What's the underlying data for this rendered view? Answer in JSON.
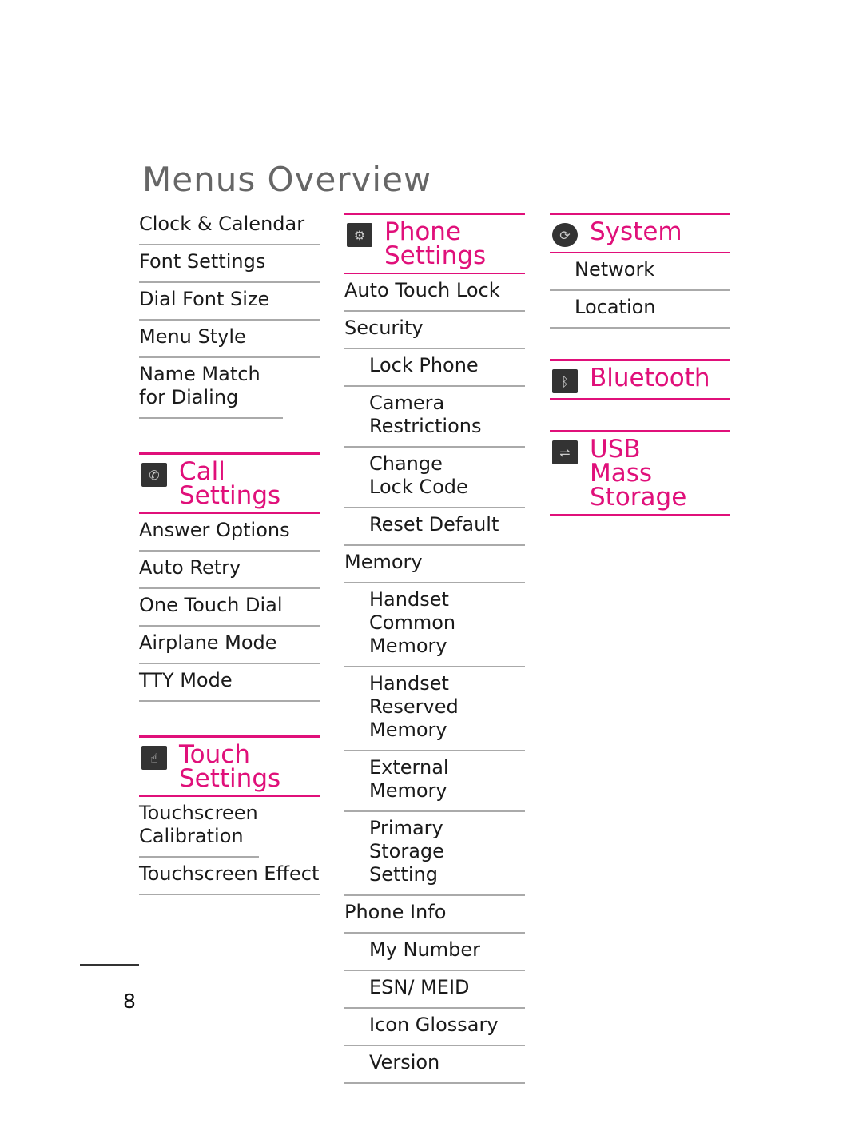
{
  "title": "Menus Overview",
  "page_number": "8",
  "accent_color": "#e0107a",
  "column1": {
    "top_items": [
      "Clock & Calendar",
      "Font Settings",
      "Dial Font Size",
      "Menu Style",
      "Name Match for Dialing"
    ],
    "call_settings": {
      "label": "Call Settings",
      "icon": "phone-gear-icon",
      "items": [
        "Answer Options",
        "Auto Retry",
        "One Touch Dial",
        "Airplane Mode",
        "TTY Mode"
      ]
    },
    "touch_settings": {
      "label": "Touch Settings",
      "icon": "touch-icon",
      "items": [
        "Touchscreen Calibration",
        "Touchscreen Effect"
      ]
    }
  },
  "column2": {
    "phone_settings": {
      "label": "Phone Settings",
      "icon": "phone-settings-icon",
      "items": [
        {
          "label": "Auto Touch Lock",
          "sub": false
        },
        {
          "label": "Security",
          "sub": false
        },
        {
          "label": "Lock Phone",
          "sub": true
        },
        {
          "label": "Camera Restrictions",
          "sub": true
        },
        {
          "label": "Change Lock Code",
          "sub": true
        },
        {
          "label": "Reset Default",
          "sub": true
        },
        {
          "label": "Memory",
          "sub": false
        },
        {
          "label": "Handset Common Memory",
          "sub": true
        },
        {
          "label": "Handset Reserved Memory",
          "sub": true
        },
        {
          "label": "External Memory",
          "sub": true
        },
        {
          "label": "Primary Storage Setting",
          "sub": true
        },
        {
          "label": "Phone Info",
          "sub": false
        },
        {
          "label": "My Number",
          "sub": true
        },
        {
          "label": "ESN/ MEID",
          "sub": true
        },
        {
          "label": "Icon Glossary",
          "sub": true
        },
        {
          "label": "Version",
          "sub": true
        }
      ]
    }
  },
  "column3": {
    "system": {
      "label": "System",
      "icon": "system-refresh-icon",
      "items": [
        "Network",
        "Location"
      ]
    },
    "bluetooth": {
      "label": "Bluetooth",
      "icon": "bluetooth-icon"
    },
    "usb": {
      "label": "USB Mass Storage",
      "icon": "usb-icon"
    }
  }
}
